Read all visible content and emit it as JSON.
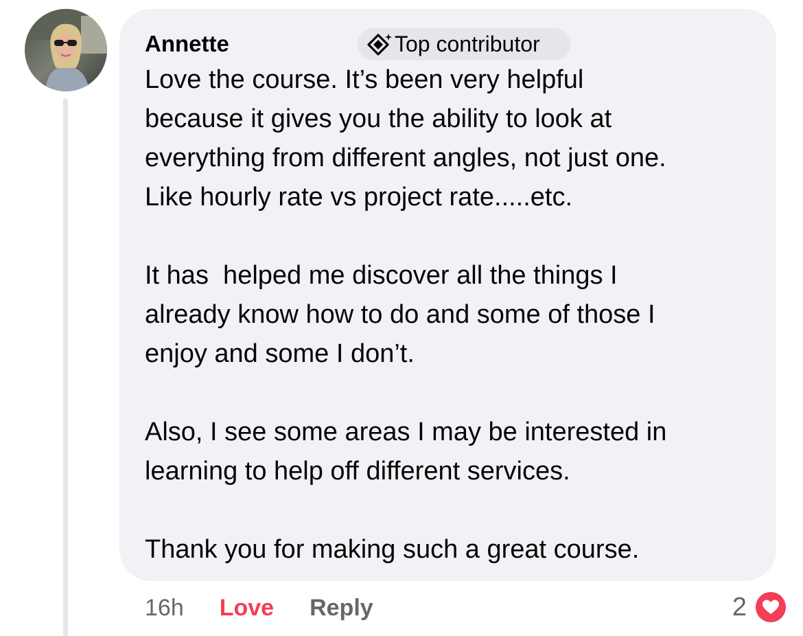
{
  "comment": {
    "author": "Annette",
    "badge": {
      "icon": "top-contributor-icon",
      "label": "Top contributor"
    },
    "paragraphs": [
      [
        "Love the course. It’s been very helpful",
        "because it gives you the ability to look at",
        "everything from different angles, not just one.",
        "Like hourly rate vs project rate.....etc."
      ],
      [
        "It has  helped me discover all the things I",
        "already know how to do and some of those I",
        "enjoy and some I don’t."
      ],
      [
        "Also, I see some areas I may be interested in",
        "learning to help off different services."
      ],
      [
        "Thank you for making such a great course."
      ]
    ]
  },
  "actions": {
    "timestamp": "16h",
    "love_label": "Love",
    "reply_label": "Reply"
  },
  "reactions": {
    "count": "2",
    "icon": "heart-icon",
    "color": "#f33e58"
  },
  "colors": {
    "bubble": "#f0f2f5",
    "secondary_text": "#65676b",
    "love": "#f33e58",
    "thread_line": "#e4e6eb"
  }
}
